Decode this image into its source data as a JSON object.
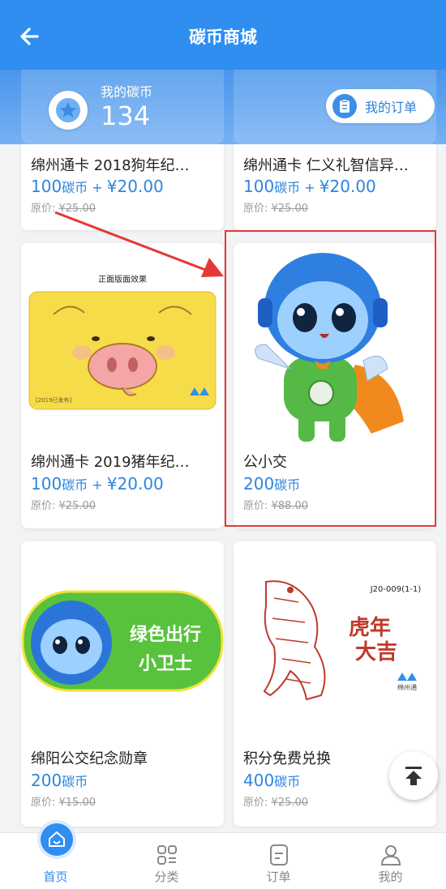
{
  "header": {
    "title": "碳币商城"
  },
  "coins": {
    "label": "我的碳币",
    "value": "134",
    "orders_label": "我的订单"
  },
  "products": [
    {
      "name": "绵州通卡 2018狗年纪…",
      "coins": "100",
      "unit": "碳币",
      "plus": " + ",
      "cash": "¥20.00",
      "orig_label": "原价: ",
      "orig": "¥25.00"
    },
    {
      "name": "绵州通卡 仁义礼智信异…",
      "coins": "100",
      "unit": "碳币",
      "plus": " + ",
      "cash": "¥20.00",
      "orig_label": "原价: ",
      "orig": "¥25.00"
    },
    {
      "name": "绵州通卡 2019猪年纪…",
      "coins": "100",
      "unit": "碳币",
      "plus": " + ",
      "cash": "¥20.00",
      "orig_label": "原价: ",
      "orig": "¥25.00",
      "img_caption": "正面版面效果",
      "img_tag": "[2019已发布]"
    },
    {
      "name": "公小交",
      "coins": "200",
      "unit": "碳币",
      "orig_label": "原价: ",
      "orig": "¥88.00"
    },
    {
      "name": "绵阳公交纪念勋章",
      "coins": "200",
      "unit": "碳币",
      "orig_label": "原价: ",
      "orig": "¥15.00",
      "badge_line1": "绿色出行",
      "badge_line2": "小卫士"
    },
    {
      "name": "积分免费兑换",
      "coins": "400",
      "unit": "碳币",
      "orig_label": "原价: ",
      "orig": "¥25.00",
      "img_code": "J20-009(1-1)",
      "img_text1": "虎年",
      "img_text2": "大吉",
      "img_brand": "绵州通"
    }
  ],
  "tabs": [
    {
      "label": "首页"
    },
    {
      "label": "分类"
    },
    {
      "label": "订单"
    },
    {
      "label": "我的"
    }
  ],
  "colors": {
    "primary": "#2f8ef0",
    "price": "#2d85e0",
    "highlight": "#e53935"
  }
}
